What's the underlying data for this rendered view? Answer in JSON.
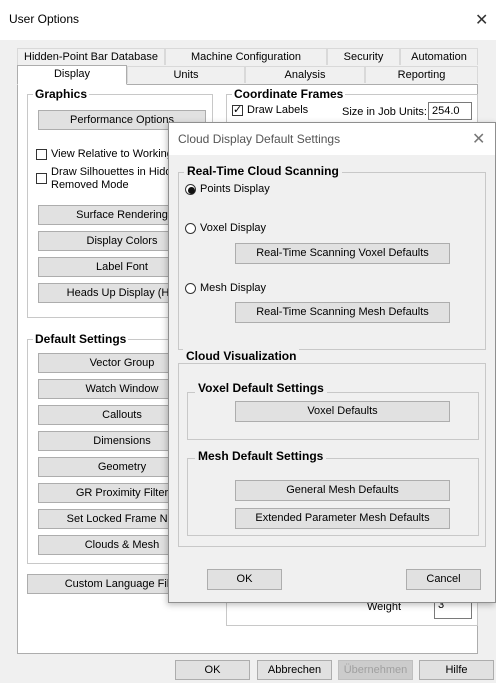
{
  "window": {
    "title": "User Options",
    "close_glyph": "✕"
  },
  "tabs_row1": [
    {
      "label": "Hidden-Point Bar Database"
    },
    {
      "label": "Machine Configuration"
    },
    {
      "label": "Security"
    },
    {
      "label": "Automation"
    }
  ],
  "tabs_row2": [
    {
      "label": "Display",
      "active": true
    },
    {
      "label": "Units"
    },
    {
      "label": "Analysis"
    },
    {
      "label": "Reporting"
    }
  ],
  "graphics": {
    "label": "Graphics",
    "performance_options": "Performance Options",
    "view_relative": "View Relative to Working",
    "draw_silhouettes_line1": "Draw Silhouettes in Hidd",
    "draw_silhouettes_line2": "Removed Mode",
    "surface_rendering": "Surface Rendering",
    "display_colors": "Display Colors",
    "label_font": "Label Font",
    "heads_up_display": "Heads Up Display (HU"
  },
  "coordinate_frames": {
    "label": "Coordinate Frames",
    "draw_labels": "Draw Labels",
    "draw_labels_checked": true,
    "size_label": "Size in Job Units:",
    "size_value": "254.0",
    "weight_label": "Weight",
    "weight_value": "3"
  },
  "default_settings": {
    "label": "Default Settings",
    "buttons": [
      "Vector Group",
      "Watch Window",
      "Callouts",
      "Dimensions",
      "Geometry",
      "GR Proximity Filter",
      "Set Locked Frame Nar",
      "Clouds & Mesh"
    ]
  },
  "custom_language": "Custom Language Fil",
  "bottom_buttons": {
    "ok": "OK",
    "cancel": "Abbrechen",
    "apply": "Übernehmen",
    "help": "Hilfe"
  },
  "dialog": {
    "title": "Cloud Display Default Settings",
    "close_glyph": "✕",
    "realtime": {
      "label": "Real-Time Cloud Scanning",
      "points": "Points Display",
      "voxel": "Voxel Display",
      "voxel_defaults": "Real-Time Scanning Voxel Defaults",
      "mesh": "Mesh Display",
      "mesh_defaults": "Real-Time Scanning Mesh Defaults",
      "selected": "points"
    },
    "visualization": {
      "label": "Cloud Visualization",
      "voxel_group": "Voxel Default Settings",
      "voxel_defaults": "Voxel Defaults",
      "mesh_group": "Mesh Default Settings",
      "general_mesh": "General Mesh Defaults",
      "extended_mesh": "Extended Parameter Mesh Defaults"
    },
    "ok": "OK",
    "cancel": "Cancel"
  }
}
